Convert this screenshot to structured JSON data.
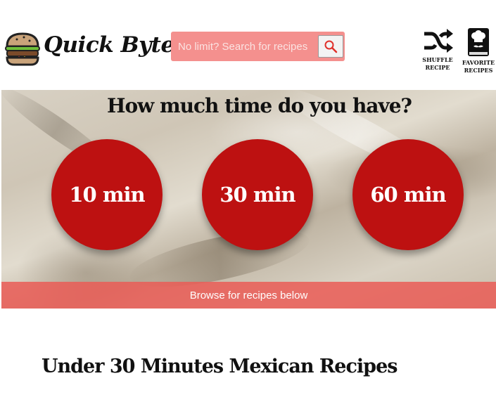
{
  "header": {
    "brand": "Quick Bytes",
    "logo_icon": "burger-icon",
    "search": {
      "placeholder": "No limit? Search for recipes",
      "button_icon": "search-icon"
    },
    "tools": [
      {
        "label": "SHUFFLE\nRECIPE",
        "icon": "shuffle-icon"
      },
      {
        "label": "FAVORITE\nRECIPES",
        "icon": "chef-book-icon"
      }
    ]
  },
  "hero": {
    "title": "How much time do you have?",
    "time_options": [
      {
        "label": "10 min"
      },
      {
        "label": "30 min"
      },
      {
        "label": "60 min"
      }
    ],
    "browse_label": "Browse for recipes below"
  },
  "section": {
    "title": "Under 30 Minutes Mexican Recipes"
  },
  "colors": {
    "accent_red": "#bd1111",
    "search_pink": "#f4908e",
    "browse_bar": "#ea5c56"
  }
}
